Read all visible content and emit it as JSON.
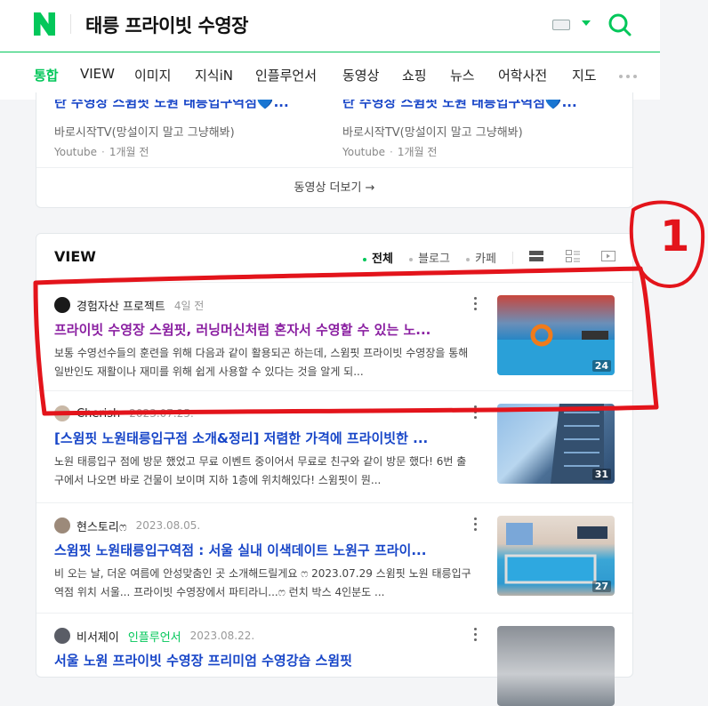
{
  "header": {
    "query": "태릉 프라이빗 수영장",
    "tabs": [
      "통합",
      "VIEW",
      "이미지",
      "지식iN",
      "인플루언서",
      "동영상",
      "쇼핑",
      "뉴스",
      "어학사전",
      "지도"
    ]
  },
  "video_cards": [
    {
      "title": "탄 수영장 스윔핏 노원 태릉입구역점💙...",
      "source": "바로시작TV(망설이지 말고 그냥해봐)",
      "platform": "Youtube",
      "age": "1개월 전"
    },
    {
      "title": "탄 수영장 스윔핏 노원 태릉입구역점💙...",
      "source": "바로시작TV(망설이지 말고 그냥해봐)",
      "platform": "Youtube",
      "age": "1개월 전"
    }
  ],
  "video_more_label": "동영상 더보기 →",
  "view": {
    "title": "VIEW",
    "filters": [
      "전체",
      "블로그",
      "카페"
    ],
    "items": [
      {
        "author": "경험자산 프로젝트",
        "influencer": "",
        "date": "4일 전",
        "title": "프라이빗 수영장 스윔핏, 러닝머신처럼 혼자서 수영할 수 있는 노...",
        "desc": "보통 수영선수들의 훈련을 위해 다음과 같이 활용되곤 하는데, 스윔핏 프라이빗 수영장을 통해 일반인도 재활이나 재미를 위해 쉽게 사용할 수 있다는 것을 알게 되...",
        "count": "24"
      },
      {
        "author": "Cherish",
        "influencer": "",
        "date": "2023.07.25.",
        "title": "[스윔핏 노원태릉입구점 소개&정리] 저렴한 가격에 프라이빗한 ...",
        "desc": "노원 태릉입구 점에 방문 했었고 무료 이벤트 중이어서 무료로 친구와 같이 방문 했다! 6번 출구에서 나오면 바로 건물이 보이며 지하 1층에 위치해있다! 스윔핏이 뭔...",
        "count": "31"
      },
      {
        "author": "현스토리ෆ",
        "influencer": "",
        "date": "2023.08.05.",
        "title": "스윔핏 노원태릉입구역점 : 서울 실내 이색데이트 노원구 프라이...",
        "desc": "비 오는 날, 더운 여름에 안성맞춤인 곳 소개해드릴게요 ෆ 2023.07.29 스윔핏 노원 태릉입구역점 위치 서울... 프라이빗 수영장에서 파티라니...ෆ 런치 박스 4인분도 ...",
        "count": "27"
      },
      {
        "author": "비서제이",
        "influencer": "인플루언서",
        "date": "2023.08.22.",
        "title": "서울 노원 프라이빗 수영장 프리미엄 수영강습 스윔핏",
        "desc": "",
        "count": ""
      }
    ]
  },
  "annotation": {
    "label": "1",
    "color": "#e3141b"
  },
  "colors": {
    "brand": "#03c75a",
    "link": "#1846c8",
    "visited": "#8a1fa1"
  }
}
